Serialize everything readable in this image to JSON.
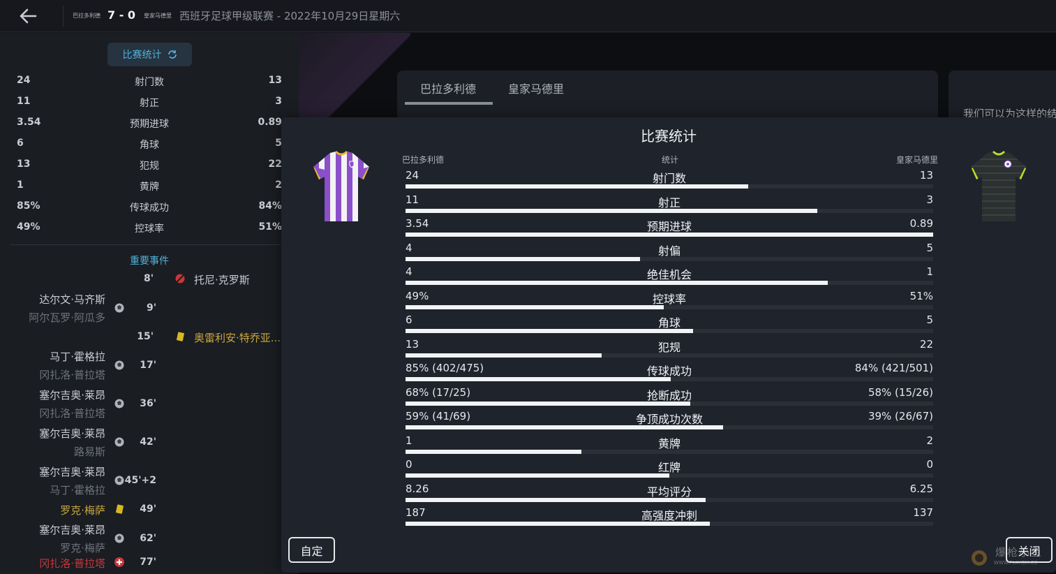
{
  "header": {
    "home_team": "巴拉多利德",
    "score": "7 - 0",
    "away_team": "皇家马德里",
    "title": "西班牙足球甲级联赛 - 2022年10月29日星期六"
  },
  "left_panel": {
    "stats_tab_label": "比赛统计",
    "stats": [
      {
        "home": "24",
        "label": "射门数",
        "away": "13"
      },
      {
        "home": "11",
        "label": "射正",
        "away": "3"
      },
      {
        "home": "3.54",
        "label": "预期进球",
        "away": "0.89"
      },
      {
        "home": "6",
        "label": "角球",
        "away": "5"
      },
      {
        "home": "13",
        "label": "犯规",
        "away": "22"
      },
      {
        "home": "1",
        "label": "黄牌",
        "away": "2"
      },
      {
        "home": "85%",
        "label": "传球成功",
        "away": "84%"
      },
      {
        "home": "49%",
        "label": "控球率",
        "away": "51%"
      }
    ],
    "events_title": "重要事件",
    "events": [
      {
        "minute": "8'",
        "side": "away",
        "type": "miss",
        "name": "托尼·克罗斯",
        "sub": ""
      },
      {
        "minute": "9'",
        "side": "home",
        "type": "goal",
        "name": "达尔文·马齐斯",
        "sub": "阿尔瓦罗·阿瓜多"
      },
      {
        "minute": "15'",
        "side": "away",
        "type": "yellow",
        "name": "奥雷利安·特乔亚...",
        "sub": ""
      },
      {
        "minute": "17'",
        "side": "home",
        "type": "goal",
        "name": "马丁·霍格拉",
        "sub": "冈扎洛·普拉塔"
      },
      {
        "minute": "36'",
        "side": "home",
        "type": "goal",
        "name": "塞尔吉奥·莱昂",
        "sub": "冈扎洛·普拉塔"
      },
      {
        "minute": "42'",
        "side": "home",
        "type": "goal",
        "name": "塞尔吉奥·莱昂",
        "sub": "路易斯"
      },
      {
        "minute": "45'+2",
        "side": "home",
        "type": "goal",
        "name": "塞尔吉奥·莱昂",
        "sub": "马丁·霍格拉"
      },
      {
        "minute": "49'",
        "side": "home",
        "type": "yellow",
        "name": "罗克·梅萨",
        "sub": ""
      },
      {
        "minute": "62'",
        "side": "home",
        "type": "goal",
        "name": "塞尔吉奥·莱昂",
        "sub": "罗克·梅萨"
      },
      {
        "minute": "77'",
        "side": "home",
        "type": "injury",
        "name": "冈扎洛·普拉塔",
        "sub": ""
      }
    ]
  },
  "background": {
    "tab_home": "巴拉多利德",
    "tab_away": "皇家马德里",
    "right_text": "我们可以为这样的结"
  },
  "modal": {
    "title": "比赛统计",
    "col_home": "巴拉多利德",
    "col_mid": "统计",
    "col_away": "皇家马德里",
    "rows": [
      {
        "home": "24",
        "label": "射门数",
        "away": "13",
        "share": 0.65
      },
      {
        "home": "11",
        "label": "射正",
        "away": "3",
        "share": 0.78
      },
      {
        "home": "3.54",
        "label": "预期进球",
        "away": "0.89",
        "share": 1.0
      },
      {
        "home": "4",
        "label": "射偏",
        "away": "5",
        "share": 0.445
      },
      {
        "home": "4",
        "label": "绝佳机会",
        "away": "1",
        "share": 0.8
      },
      {
        "home": "49%",
        "label": "控球率",
        "away": "51%",
        "share": 0.49
      },
      {
        "home": "6",
        "label": "角球",
        "away": "5",
        "share": 0.545
      },
      {
        "home": "13",
        "label": "犯规",
        "away": "22",
        "share": 0.372
      },
      {
        "home": "85% (402/475)",
        "label": "传球成功",
        "away": "84% (421/501)",
        "share": 0.503
      },
      {
        "home": "68% (17/25)",
        "label": "抢断成功",
        "away": "58% (15/26)",
        "share": 0.54
      },
      {
        "home": "59% (41/69)",
        "label": "争顶成功次数",
        "away": "39% (26/67)",
        "share": 0.602
      },
      {
        "home": "1",
        "label": "黄牌",
        "away": "2",
        "share": 0.333
      },
      {
        "home": "0",
        "label": "红牌",
        "away": "0",
        "share": 0.5
      },
      {
        "home": "8.26",
        "label": "平均评分",
        "away": "6.25",
        "share": 0.569
      },
      {
        "home": "187",
        "label": "高强度冲刺",
        "away": "137",
        "share": 0.577
      }
    ],
    "custom_label": "自定",
    "close_label": "关闭"
  },
  "watermark": {
    "big": "爆枪小鱼",
    "small": "WWW.PLAYGM.CC"
  },
  "colors": {
    "accent": "#4fb3d9",
    "home_kit": "#8a4fc9",
    "away_kit": "#2c3030",
    "away_trim": "#b8e02a"
  }
}
